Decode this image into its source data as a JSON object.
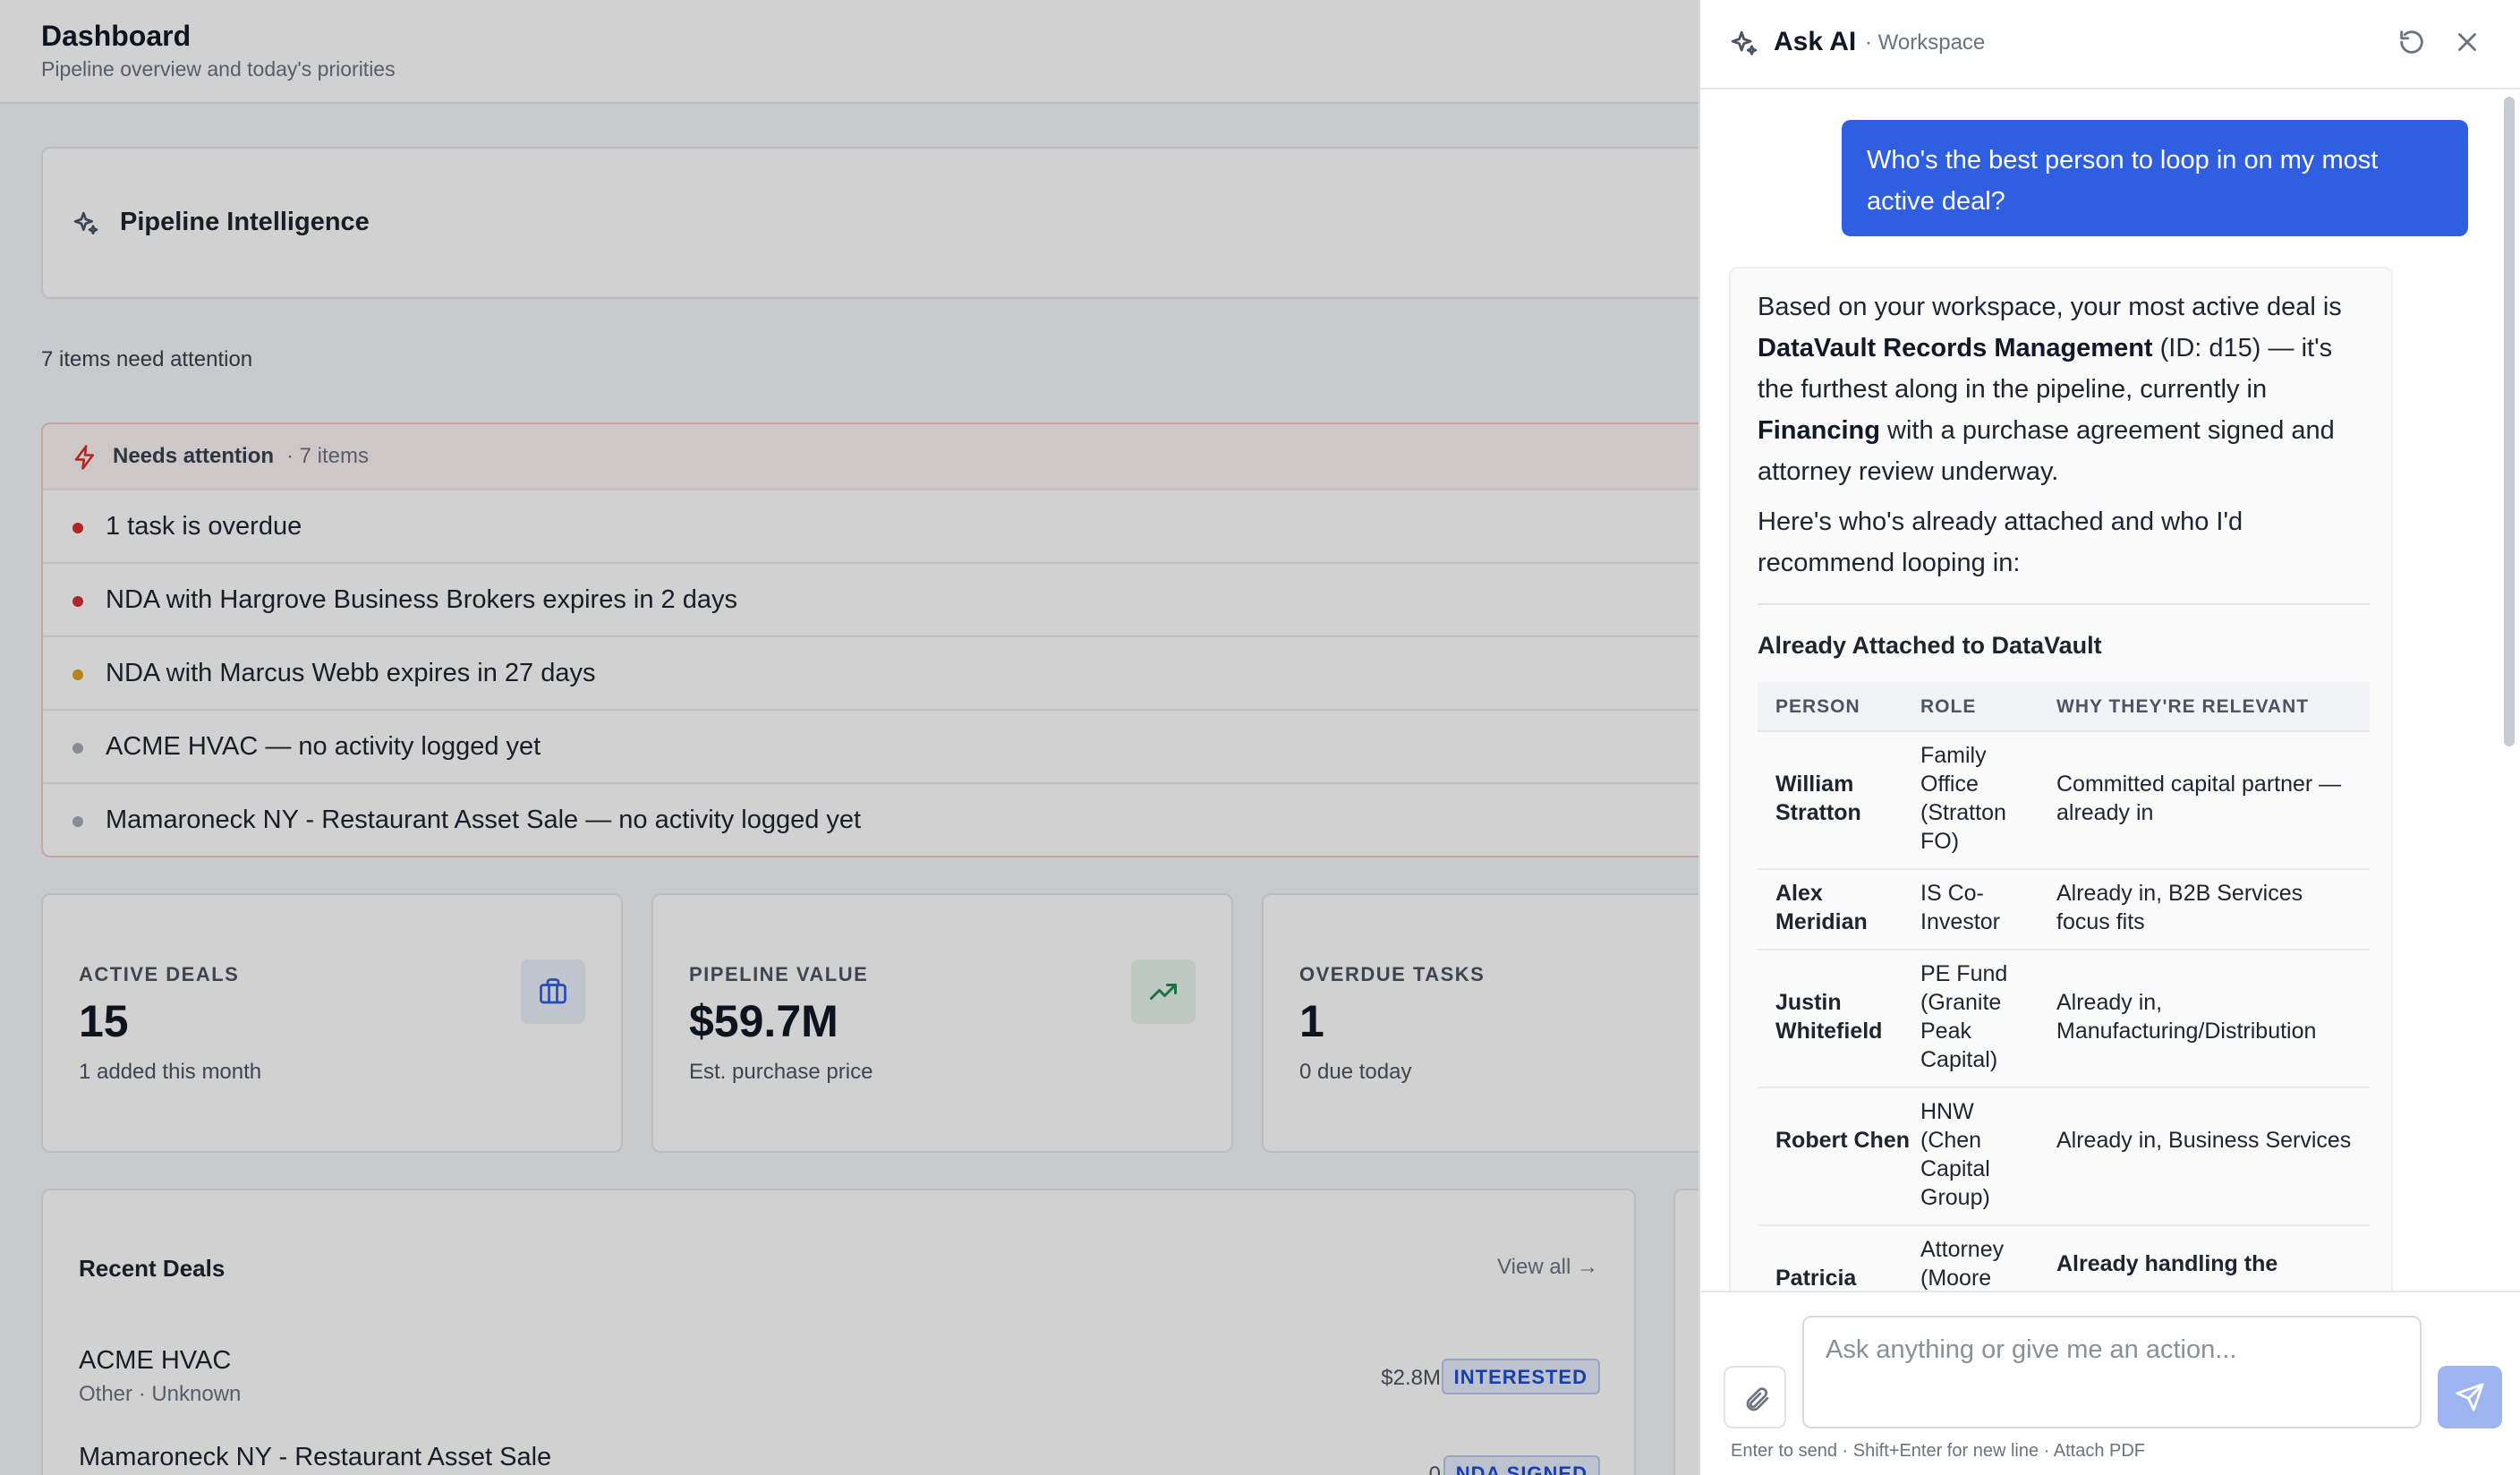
{
  "header": {
    "title": "Dashboard",
    "subtitle": "Pipeline overview and today's priorities"
  },
  "pipeline_intelligence": {
    "title": "Pipeline Intelligence",
    "attention_count": "7 items need attention"
  },
  "needs_attention": {
    "title": "Needs attention",
    "count": "· 7 items",
    "items": [
      {
        "text": "1 task is overdue",
        "color": "#d62f2f"
      },
      {
        "text": "NDA with Hargrove Business Brokers expires in 2 days",
        "color": "#d62f2f"
      },
      {
        "text": "NDA with Marcus Webb expires in 27 days",
        "color": "#e0a21b"
      },
      {
        "text": "ACME HVAC — no activity logged yet",
        "color": "#a6abb3"
      },
      {
        "text": "Mamaroneck NY - Restaurant Asset Sale — no activity logged yet",
        "color": "#a6abb3"
      }
    ]
  },
  "stats": [
    {
      "label": "ACTIVE DEALS",
      "value": "15",
      "sub": "1 added this month",
      "icon": "briefcase-icon"
    },
    {
      "label": "PIPELINE VALUE",
      "value": "$59.7M",
      "sub": "Est. purchase price",
      "icon": "trending-up-icon"
    },
    {
      "label": "OVERDUE TASKS",
      "value": "1",
      "sub": "0 due today",
      "icon": ""
    }
  ],
  "recent_deals": {
    "title": "Recent Deals",
    "view_all": "View all →",
    "deals": [
      {
        "name": "ACME HVAC",
        "meta": "Other · Unknown",
        "value": "$2.8M",
        "status": "INTERESTED"
      },
      {
        "name": "Mamaroneck NY - Restaurant Asset Sale",
        "meta": "",
        "value": "0",
        "status": "NDA SIGNED"
      }
    ]
  },
  "ai_panel": {
    "title": "Ask AI",
    "context": "· Workspace",
    "user_message": "Who's the best person to loop in on my most active deal?",
    "response": {
      "p1_a": "Based on your workspace, your most active deal is ",
      "p1_b": "DataVault Records Management",
      "p1_c": " (ID: d15) — it's the furthest along in the pipeline, currently in ",
      "p1_d": "Financing",
      "p1_e": " with a purchase agreement signed and attorney review underway.",
      "p2": "Here's who's already attached and who I'd recommend looping in:",
      "heading": "Already Attached to DataVault",
      "columns": [
        "PERSON",
        "ROLE",
        "WHY THEY'RE RELEVANT"
      ],
      "rows": [
        {
          "person": "William Stratton",
          "role": "Family Office (Stratton FO)",
          "why": "Committed capital partner — already in"
        },
        {
          "person": "Alex Meridian",
          "role": "IS Co-Investor",
          "why": "Already in, B2B Services focus fits"
        },
        {
          "person": "Justin Whitefield",
          "role": "PE Fund (Granite Peak Capital)",
          "why": "Already in, Manufacturing/Distribution"
        },
        {
          "person": "Robert Chen",
          "role": "HNW (Chen Capital Group)",
          "why": "Already in, Business Services"
        },
        {
          "person": "Patricia",
          "role": "Attorney (Moore",
          "why": "Already handling the"
        }
      ]
    },
    "input_placeholder": "Ask anything or give me an action...",
    "hint": "Enter to send · Shift+Enter for new line · Attach PDF"
  }
}
